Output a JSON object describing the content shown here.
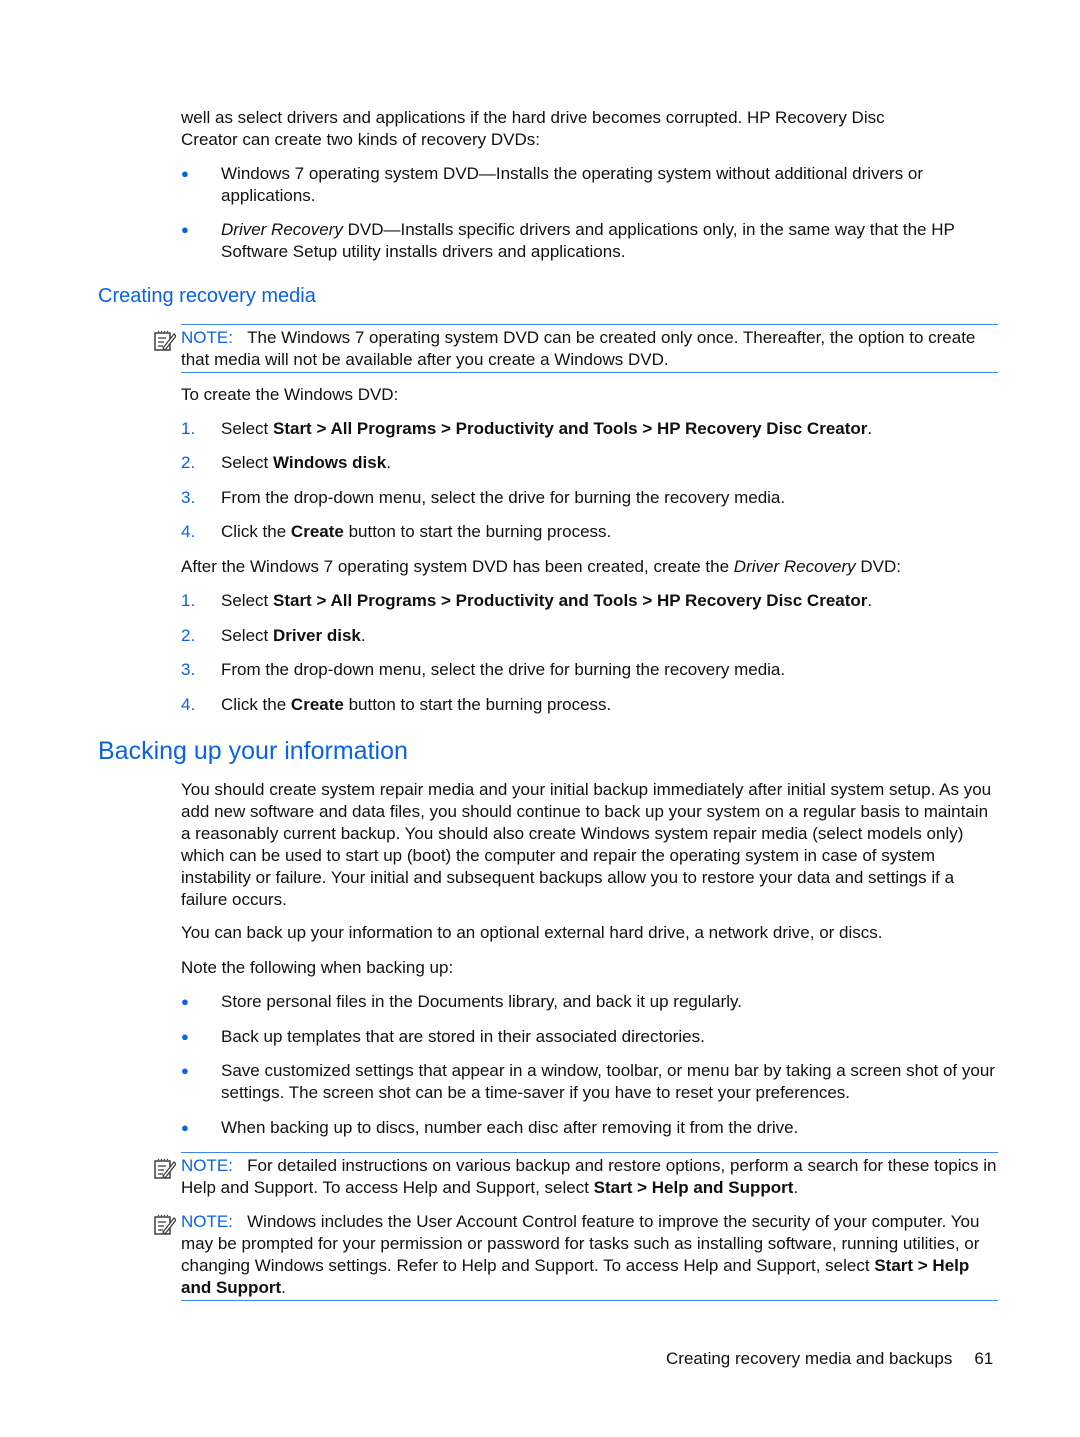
{
  "intro": {
    "line1": "well as select drivers and applications if the hard drive becomes corrupted. HP Recovery Disc",
    "line2": "Creator can create two kinds of recovery DVDs:",
    "bullets": [
      {
        "lead": "",
        "text": "Windows 7 operating system DVD—Installs the operating system without additional drivers or applications."
      },
      {
        "lead": "Driver Recovery",
        "text": " DVD—Installs specific drivers and applications only, in the same way that the HP Software Setup utility installs drivers and applications."
      }
    ]
  },
  "section_creating": {
    "heading": "Creating recovery media",
    "note": {
      "label": "NOTE:",
      "text": "The Windows 7 operating system DVD can be created only once. Thereafter, the option to create that media will not be available after you create a Windows DVD."
    },
    "intro1": "To create the Windows DVD:",
    "steps1": [
      {
        "num": "1.",
        "pre": "Select ",
        "bold": "Start > All Programs > Productivity and Tools > HP Recovery Disc Creator",
        "post": "."
      },
      {
        "num": "2.",
        "pre": "Select ",
        "bold": "Windows disk",
        "post": "."
      },
      {
        "num": "3.",
        "pre": "From the drop-down menu, select the drive for burning the recovery media.",
        "bold": "",
        "post": ""
      },
      {
        "num": "4.",
        "pre": "Click the ",
        "bold": "Create",
        "post": " button to start the burning process."
      }
    ],
    "intro2_pre": "After the Windows 7 operating system DVD has been created, create the ",
    "intro2_italic": "Driver Recovery",
    "intro2_post": " DVD:",
    "steps2": [
      {
        "num": "1.",
        "pre": "Select ",
        "bold": "Start > All Programs > Productivity and Tools > HP Recovery Disc Creator",
        "post": "."
      },
      {
        "num": "2.",
        "pre": "Select ",
        "bold": "Driver disk",
        "post": "."
      },
      {
        "num": "3.",
        "pre": "From the drop-down menu, select the drive for burning the recovery media.",
        "bold": "",
        "post": ""
      },
      {
        "num": "4.",
        "pre": "Click the ",
        "bold": "Create",
        "post": " button to start the burning process."
      }
    ]
  },
  "section_backup": {
    "heading": "Backing up your information",
    "para1": "You should create system repair media and your initial backup immediately after initial system setup. As you add new software and data files, you should continue to back up your system on a regular basis to maintain a reasonably current backup. You should also create Windows system repair media (select models only) which can be used to start up (boot) the computer and repair the operating system in case of system instability or failure. Your initial and subsequent backups allow you to restore your data and settings if a failure occurs.",
    "para2": "You can back up your information to an optional external hard drive, a network drive, or discs.",
    "para3": "Note the following when backing up:",
    "bullets": [
      "Store personal files in the Documents library, and back it up regularly.",
      "Back up templates that are stored in their associated directories.",
      "Save customized settings that appear in a window, toolbar, or menu bar by taking a screen shot of your settings. The screen shot can be a time-saver if you have to reset your preferences.",
      "When backing up to discs, number each disc after removing it from the drive."
    ],
    "note1": {
      "label": "NOTE:",
      "pre": "For detailed instructions on various backup and restore options, perform a search for these topics in Help and Support. To access Help and Support, select ",
      "bold": "Start > Help and Support",
      "post": "."
    },
    "note2": {
      "label": "NOTE:",
      "pre": "Windows includes the User Account Control feature to improve the security of your computer. You may be prompted for your permission or password for tasks such as installing software, running utilities, or changing Windows settings. Refer to Help and Support. To access Help and Support, select ",
      "bold": "Start > Help and Support",
      "post": "."
    }
  },
  "footer": {
    "chapter": "Creating recovery media and backups",
    "page": "61"
  },
  "icons": {
    "bullet": "●",
    "note": "note-pencil-icon"
  },
  "colors": {
    "accent": "#0a63e6",
    "rule": "#3d86ee"
  }
}
